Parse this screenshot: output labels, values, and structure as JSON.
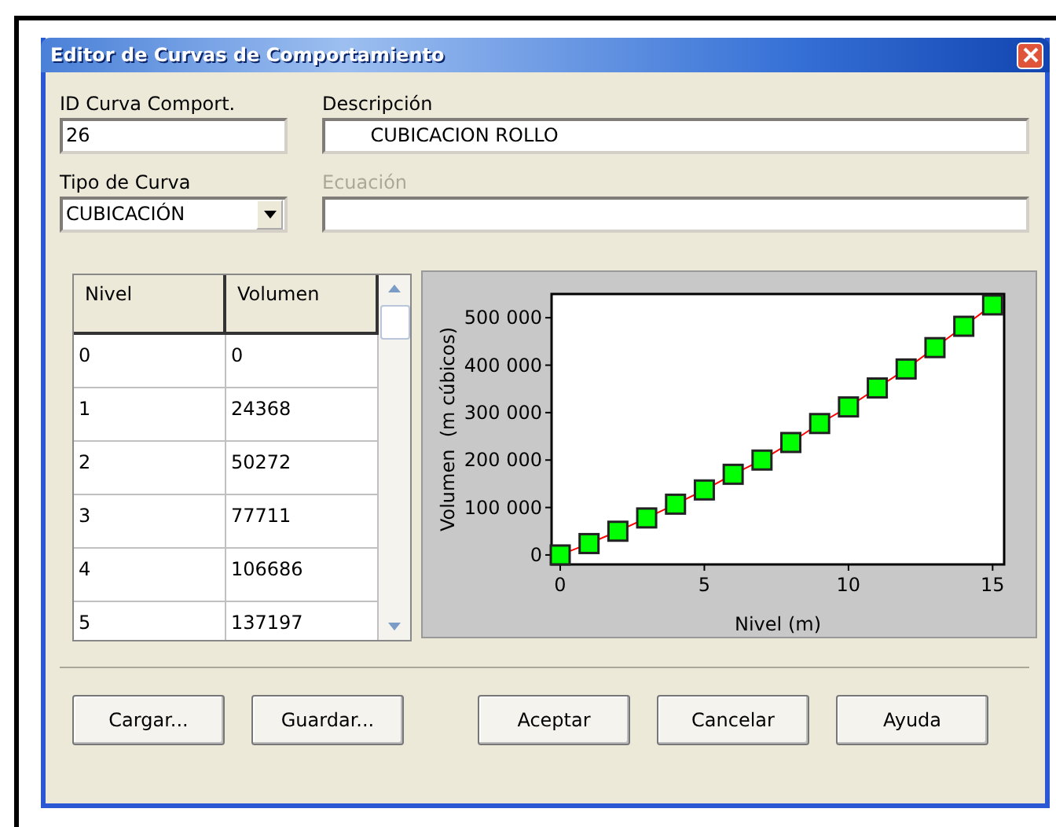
{
  "window": {
    "title": "Editor de Curvas de Comportamiento"
  },
  "fields": {
    "id": {
      "label": "ID Curva Comport.",
      "value": "26"
    },
    "description": {
      "label": "Descripción",
      "value": "       CUBICACION ROLLO"
    },
    "curve_type": {
      "label": "Tipo de Curva",
      "value": "CUBICACIÓN"
    },
    "equation": {
      "label": "Ecuación",
      "disabled": true
    }
  },
  "table": {
    "columns": [
      "Nivel",
      "Volumen"
    ],
    "rows": [
      [
        "0",
        "0"
      ],
      [
        "1",
        "24368"
      ],
      [
        "2",
        "50272"
      ],
      [
        "3",
        "77711"
      ],
      [
        "4",
        "106686"
      ],
      [
        "5",
        "137197"
      ]
    ]
  },
  "chart_data": {
    "type": "line",
    "xlabel": "Nivel (m)",
    "ylabel": "Volumen  (m cúbicos)",
    "x": [
      0,
      1,
      2,
      3,
      4,
      5,
      6,
      7,
      8,
      9,
      10,
      11,
      12,
      13,
      14,
      15
    ],
    "series": [
      {
        "color": "#ff0000",
        "marker": "square",
        "values": [
          0,
          24000,
          50000,
          78000,
          107000,
          137000,
          170000,
          200000,
          237000,
          277000,
          312000,
          352000,
          392000,
          437000,
          482000,
          527000
        ]
      }
    ],
    "xlim": [
      -0.3,
      15.4
    ],
    "ylim": [
      -20000,
      550000
    ],
    "xticks": [
      0,
      5,
      10,
      15
    ],
    "yticks": [
      {
        "value": 0,
        "label": "0"
      },
      {
        "value": 100000,
        "label": "100 000"
      },
      {
        "value": 200000,
        "label": "200 000"
      },
      {
        "value": 300000,
        "label": "300 000"
      },
      {
        "value": 400000,
        "label": "400 000"
      },
      {
        "value": 500000,
        "label": "500 000"
      }
    ]
  },
  "buttons": [
    "Cargar...",
    "Guardar...",
    "Aceptar",
    "Cancelar",
    "Ayuda"
  ]
}
